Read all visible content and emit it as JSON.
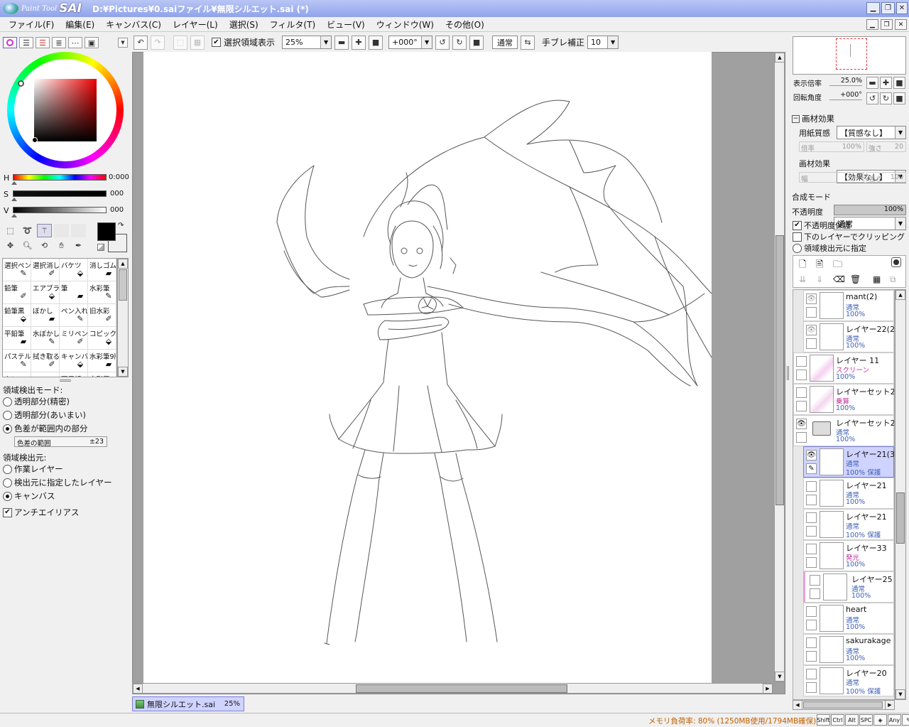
{
  "app": {
    "logo_small": "Paint Tool",
    "logo_big": "SAI",
    "title": "D:¥Pictures¥0.saiファイル¥無限シルエット.sai (*)"
  },
  "menu": [
    "ファイル(F)",
    "編集(E)",
    "キャンバス(C)",
    "レイヤー(L)",
    "選択(S)",
    "フィルタ(T)",
    "ビュー(V)",
    "ウィンドウ(W)",
    "その他(O)"
  ],
  "toolbar": {
    "show_selection_label": "選択領域表示",
    "zoom": "25%",
    "rotation": "+000°",
    "blend_mode": "通常",
    "stabilizer_label": "手ブレ補正",
    "stabilizer_value": "10"
  },
  "color": {
    "h_label": "H",
    "h_value": "0:000",
    "s_label": "S",
    "s_value": "000",
    "v_label": "V",
    "v_value": "000",
    "primary": "#000000",
    "secondary": "#ffffff"
  },
  "tools": [
    [
      "選択ペン",
      "選択消し",
      "バケツ",
      "消しゴム"
    ],
    [
      "鉛筆",
      "エアブラシ",
      "筆",
      "水彩筆"
    ],
    [
      "鉛筆黒",
      "ぼかし",
      "ペン入れ",
      "旧水彩"
    ],
    [
      "平鉛筆",
      "水ぼかし",
      "ミリペン用",
      "コピック"
    ],
    [
      "パステル",
      "拭き取る",
      "キャンバスアクリル",
      "水彩筆9版"
    ]
  ],
  "tools_partial": [
    "クレヨン",
    "",
    "面用紙",
    "水彩筆"
  ],
  "detect": {
    "mode_label": "領域検出モード:",
    "mode_options": [
      "透明部分(精密)",
      "透明部分(あいまい)",
      "色差が範囲内の部分"
    ],
    "range_label": "色差の範囲",
    "range_value": "±23",
    "source_label": "領域検出元:",
    "source_options": [
      "作業レイヤー",
      "検出元に指定したレイヤー",
      "キャンバス"
    ],
    "antialias_label": "アンチエイリアス"
  },
  "navigator": {
    "zoom_label": "表示倍率",
    "zoom_value": "25.0%",
    "rotate_label": "回転角度",
    "rotate_value": "+000°"
  },
  "paper_effect": {
    "header": "画材効果",
    "texture_label": "用紙質感",
    "texture_value": "【質感なし】",
    "scale_label": "倍率",
    "scale_value": "100%",
    "strength_label": "強さ",
    "strength_value": "20",
    "effect_label": "画材効果",
    "effect_value": "【効果なし】",
    "width_label": "幅",
    "width_value": "1",
    "strength2_label": "強さ",
    "strength2_value": "100"
  },
  "layer_props": {
    "blend_label": "合成モード",
    "blend_value": "通常",
    "opacity_label": "不透明度",
    "opacity_value": "100%",
    "preserve_opacity": "不透明度保護",
    "clip_below": "下のレイヤーでクリッピング",
    "detect_source": "領域検出元に指定"
  },
  "layers": [
    {
      "name": "mant(2)",
      "mode": "通常",
      "opacity": "100%",
      "protect": ""
    },
    {
      "name": "レイヤー22(2)",
      "mode": "通常",
      "opacity": "100%",
      "protect": ""
    },
    {
      "name": "レイヤー 11",
      "mode": "スクリーン",
      "opacity": "100%",
      "protect": ""
    },
    {
      "name": "レイヤーセット2...",
      "mode": "乗算",
      "opacity": "100%",
      "protect": ""
    },
    {
      "name": "レイヤーセット2",
      "mode": "通常",
      "opacity": "100%",
      "protect": ""
    },
    {
      "name": "レイヤー21(3)",
      "mode": "通常",
      "opacity": "100%",
      "protect": "保護"
    },
    {
      "name": "レイヤー21",
      "mode": "通常",
      "opacity": "100%",
      "protect": ""
    },
    {
      "name": "レイヤー21",
      "mode": "通常",
      "opacity": "100%",
      "protect": "保護"
    },
    {
      "name": "レイヤー33",
      "mode": "発光",
      "opacity": "100%",
      "protect": ""
    },
    {
      "name": "レイヤー25",
      "mode": "通常",
      "opacity": "100%",
      "protect": ""
    },
    {
      "name": "heart",
      "mode": "通常",
      "opacity": "100%",
      "protect": ""
    },
    {
      "name": "sakurakage",
      "mode": "通常",
      "opacity": "100%",
      "protect": ""
    },
    {
      "name": "レイヤー20",
      "mode": "通常",
      "opacity": "100%",
      "protect": "保護"
    }
  ],
  "doc_tab": {
    "name": "無限シルエット.sai",
    "zoom": "25%"
  },
  "status": {
    "memory": "メモリ負荷率: 80% (1250MB使用/1794MB確保)",
    "keys": [
      "Shift",
      "Ctrl",
      "Alt",
      "SPC",
      "◈",
      "Any",
      "✎"
    ]
  }
}
